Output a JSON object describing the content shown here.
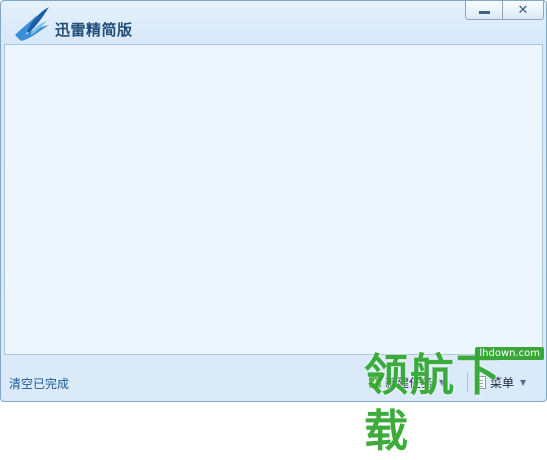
{
  "window": {
    "title": "迅雷精简版",
    "minimize_label": "minimize",
    "close_label": "close"
  },
  "footer": {
    "clear_label": "清空已完成",
    "new_task_label": "新建任务",
    "menu_label": "菜单"
  },
  "watermark": {
    "site": "lhdown.com",
    "brand": "领航下载"
  },
  "icons": {
    "logo": "bird-logo-icon",
    "new_task": "plus-icon",
    "menu": "document-icon"
  },
  "colors": {
    "title": "#1f4e79",
    "link": "#1b5b9a",
    "content_bg": "#eef6fd",
    "watermark": "#34a833"
  }
}
